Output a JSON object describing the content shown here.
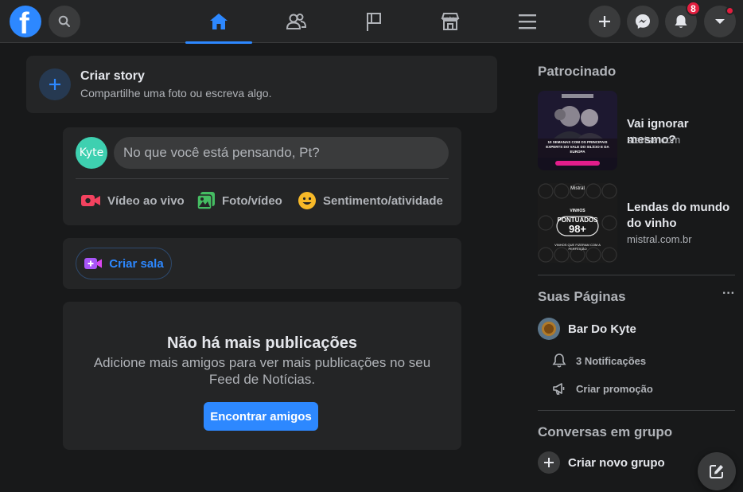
{
  "topbar": {
    "logo_letter": "f",
    "notifications_count": "8",
    "accent_color": "#2d88ff",
    "icons": [
      "search-icon",
      "home-icon",
      "friends-icon",
      "pages-flag-icon",
      "marketplace-icon",
      "menu-icon",
      "plus-icon",
      "messenger-icon",
      "bell-icon",
      "caret-down-icon"
    ]
  },
  "story": {
    "title": "Criar story",
    "subtitle": "Compartilhe uma foto ou escreva algo."
  },
  "composer": {
    "avatar_text": "Kyte",
    "placeholder": "No que você está pensando, Pt?",
    "actions": [
      {
        "label": "Vídeo ao vivo",
        "icon": "live-video-icon",
        "color": "#f3425f"
      },
      {
        "label": "Foto/vídeo",
        "icon": "photo-icon",
        "color": "#45bd62"
      },
      {
        "label": "Sentimento/atividade",
        "icon": "feeling-icon",
        "color": "#f7b928"
      }
    ]
  },
  "room": {
    "label": "Criar sala"
  },
  "empty_feed": {
    "title": "Não há mais publicações",
    "text": "Adicione mais amigos para ver mais publicações no seu Feed de Notícias.",
    "button": "Encontrar amigos"
  },
  "sidebar": {
    "sponsored_title": "Patrocinado",
    "ads": [
      {
        "title": "Vai ignorar mesmo?",
        "domain": "startse.com",
        "thumb_text": "10 SEMANAS COM OS PRINCIPAIS EXPERTS DO VALE DO SILÍCIO E DA EUROPA"
      },
      {
        "title": "Lendas do mundo do vinho",
        "domain": "mistral.com.br",
        "thumb_brand": "Mistral",
        "thumb_top": "VINHOS",
        "thumb_mid": "PONTUADOS",
        "thumb_big": "98+",
        "thumb_bottom": "VINHOS QUE FIZERAM COM A PERFEIÇÃO"
      }
    ],
    "pages_title": "Suas Páginas",
    "pages_more": "···",
    "page_name": "Bar Do Kyte",
    "page_notifications": "3 Notificações",
    "page_promo": "Criar promoção",
    "groups_title": "Conversas em grupo",
    "create_group": "Criar novo grupo"
  }
}
